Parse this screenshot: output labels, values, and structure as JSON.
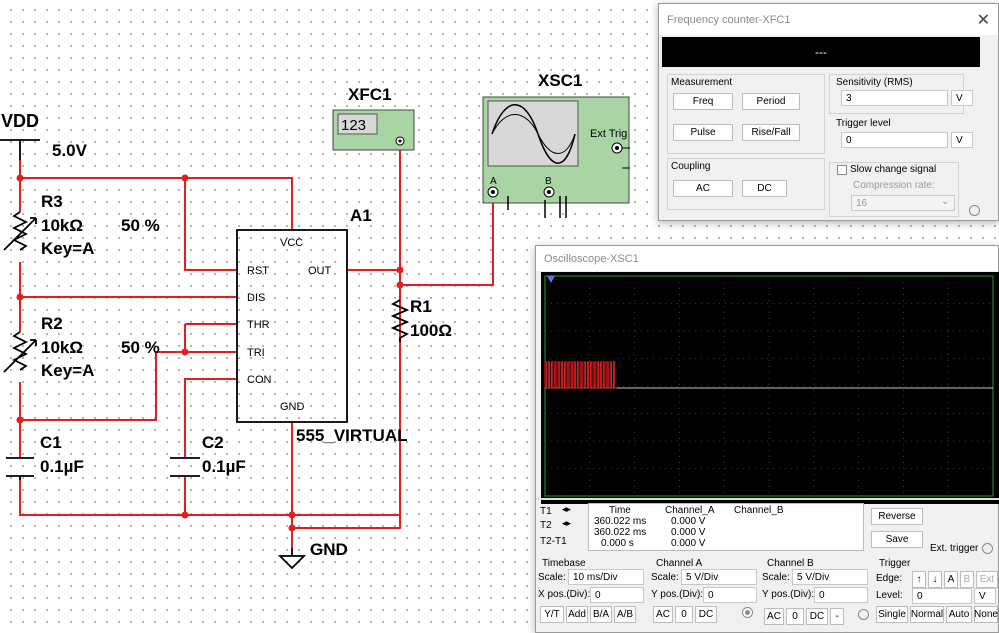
{
  "schematic": {
    "vdd": {
      "name": "VDD",
      "voltage": "5.0V"
    },
    "r3": {
      "name": "R3",
      "value": "10kΩ",
      "setting": "50 %",
      "key": "Key=A"
    },
    "r2": {
      "name": "R2",
      "value": "10kΩ",
      "setting": "50 %",
      "key": "Key=A"
    },
    "r1": {
      "name": "R1",
      "value": "100Ω"
    },
    "c1": {
      "name": "C1",
      "value": "0.1µF"
    },
    "c2": {
      "name": "C2",
      "value": "0.1µF"
    },
    "a1": {
      "name": "A1",
      "part": "555_VIRTUAL",
      "pins": {
        "vcc": "VCC",
        "rst": "RST",
        "out": "OUT",
        "dis": "DIS",
        "thr": "THR",
        "tri": "TRI",
        "con": "CON",
        "gnd": "GND"
      }
    },
    "xfc1": {
      "name": "XFC1",
      "display": "123"
    },
    "xsc1": {
      "name": "XSC1",
      "ext_trig": "Ext Trig",
      "ch_a": "A",
      "ch_b": "B"
    },
    "gnd": "GND",
    "colors": {
      "wire": "#e41e1e",
      "node": "#e41e1e",
      "instrument": "#a9d5a4"
    }
  },
  "freq_counter": {
    "title": "Frequency counter-XFC1",
    "display": "---",
    "measurement": {
      "label": "Measurement",
      "buttons": [
        "Freq",
        "Period",
        "Pulse",
        "Rise/Fall"
      ]
    },
    "coupling": {
      "label": "Coupling",
      "buttons": [
        "AC",
        "DC"
      ]
    },
    "sensitivity": {
      "label": "Sensitivity (RMS)",
      "value": "3",
      "unit": "V"
    },
    "trigger": {
      "label": "Trigger level",
      "value": "0",
      "unit": "V"
    },
    "slow_change": {
      "label": "Slow change signal",
      "checked": false
    },
    "compression": {
      "label": "Compression rate:",
      "value": "16"
    }
  },
  "oscilloscope": {
    "title": "Oscilloscope-XSC1",
    "readout": {
      "headers": [
        "Time",
        "Channel_A",
        "Channel_B"
      ],
      "rows": [
        {
          "label": "T1",
          "time": "360.022 ms",
          "a": "0.000 V",
          "b": ""
        },
        {
          "label": "T2",
          "time": "360.022 ms",
          "a": "0.000 V",
          "b": ""
        },
        {
          "label": "T2-T1",
          "time": "0.000 s",
          "a": "0.000 V",
          "b": ""
        }
      ]
    },
    "buttons": {
      "reverse": "Reverse",
      "save": "Save",
      "ext_trigger": "Ext. trigger"
    },
    "timebase": {
      "label": "Timebase",
      "scale_label": "Scale:",
      "scale": "10 ms/Div",
      "xpos_label": "X pos.(Div):",
      "xpos": "0",
      "modes": [
        "Y/T",
        "Add",
        "B/A",
        "A/B"
      ]
    },
    "channel_a": {
      "label": "Channel A",
      "scale_label": "Scale:",
      "scale": "5 V/Div",
      "ypos_label": "Y pos.(Div):",
      "ypos": "0",
      "coupling": [
        "AC",
        "0",
        "DC"
      ]
    },
    "channel_b": {
      "label": "Channel B",
      "scale_label": "Scale:",
      "scale": "5 V/Div",
      "ypos_label": "Y pos.(Div):",
      "ypos": "0",
      "coupling": [
        "AC",
        "0",
        "DC",
        "-"
      ]
    },
    "trigger": {
      "label": "Trigger",
      "edge_label": "Edge:",
      "edge_buttons": [
        "A",
        "B",
        "Ext"
      ],
      "level_label": "Level:",
      "level": "0",
      "level_unit": "V",
      "modes": [
        "Single",
        "Normal",
        "Auto",
        "None"
      ]
    },
    "trace": {
      "color": "#e02020",
      "pulse_count": 22,
      "start_div": 0,
      "end_div": 1.6,
      "high_div": 0.95
    }
  }
}
